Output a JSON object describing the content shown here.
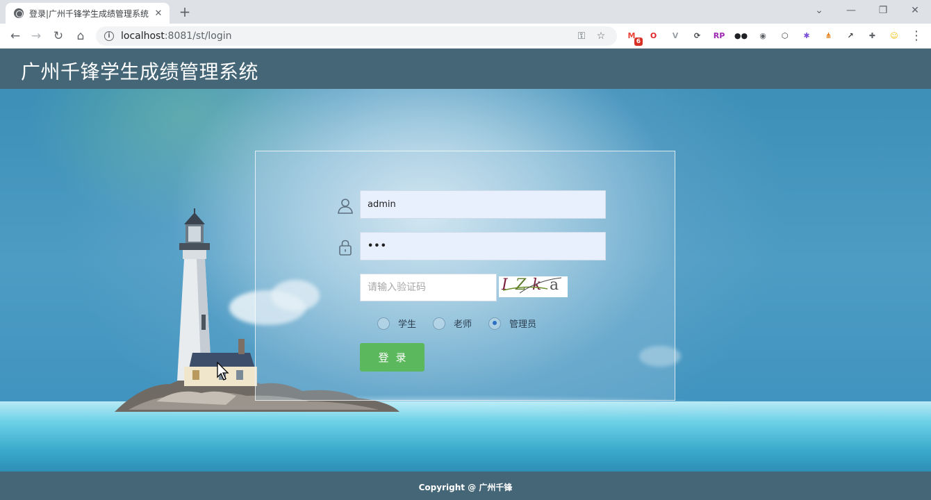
{
  "browser": {
    "tab_title": "登录|广州千锋学生成绩管理系统",
    "tab_close": "✕",
    "new_tab": "+",
    "url_host": "localhost",
    "url_path": ":8081/st/login",
    "extensions": [
      {
        "name": "gmail-extension-icon",
        "label": "M",
        "color": "#ea4335",
        "badge": "6"
      },
      {
        "name": "opera-extension-icon",
        "label": "O",
        "color": "#e0252e"
      },
      {
        "name": "vue-devtools-extension-icon",
        "label": "V",
        "color": "#9aa0a6"
      },
      {
        "name": "sync-extension-icon",
        "label": "⟳",
        "color": "#3c4043"
      },
      {
        "name": "rp-extension-icon",
        "label": "RP",
        "color": "#9c27b0"
      },
      {
        "name": "lens-extension-icon",
        "label": "●●",
        "color": "#202124"
      },
      {
        "name": "camera-extension-icon",
        "label": "◉",
        "color": "#5f6368"
      },
      {
        "name": "shield-extension-icon",
        "label": "⬡",
        "color": "#3c4043"
      },
      {
        "name": "color-extension-icon",
        "label": "✱",
        "color": "#7b4fd6"
      },
      {
        "name": "sitemap-extension-icon",
        "label": "⋔",
        "color": "#e37400"
      },
      {
        "name": "chart-extension-icon",
        "label": "↗",
        "color": "#3c4043"
      },
      {
        "name": "puzzle-extension-icon",
        "label": "✚",
        "color": "#5f6368"
      },
      {
        "name": "profile-avatar-icon",
        "label": "☺",
        "color": "#fbbc04"
      }
    ]
  },
  "site": {
    "title": "广州千锋学生成绩管理系统",
    "footer": "Copyright @ 广州千锋"
  },
  "login": {
    "username_value": "admin",
    "password_value": "•••",
    "captcha_placeholder": "请输入验证码",
    "captcha_text": [
      "I",
      "Z",
      "k",
      "a"
    ],
    "roles": [
      {
        "label": "学生",
        "checked": false
      },
      {
        "label": "老师",
        "checked": false
      },
      {
        "label": "管理员",
        "checked": true
      }
    ],
    "submit_label": "登录"
  }
}
